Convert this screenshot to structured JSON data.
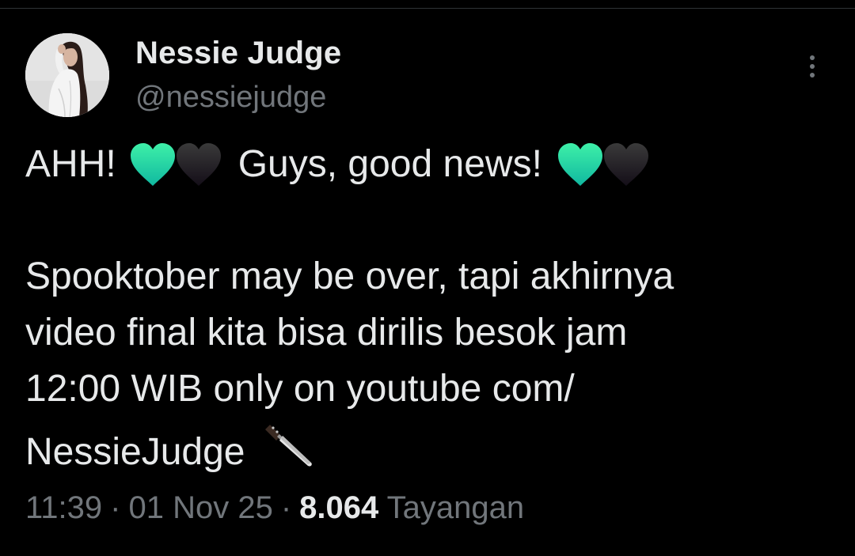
{
  "tweet": {
    "author": {
      "display_name": "Nessie Judge",
      "handle": "@nessiejudge",
      "avatar_icon": "profile-photo"
    },
    "more_icon": "more-vertical-icon",
    "text": {
      "line1_part1": "AHH!",
      "line1_part2": "Guys, good news!",
      "line3": "Spooktober may be over, tapi akhirnya",
      "line4": "video final kita bisa dirilis besok jam",
      "line5": "12:00 WIB only on youtube com/",
      "line6": "NessieJudge"
    },
    "emojis": [
      "green-heart-icon",
      "black-heart-icon",
      "green-heart-icon",
      "black-heart-icon",
      "knife-icon"
    ],
    "meta": {
      "time": "11:39",
      "separator": "·",
      "date": "01 Nov 25",
      "views_count": "8.064",
      "views_label": "Tayangan"
    },
    "colors": {
      "background": "#000000",
      "primary_text": "#e7e9ea",
      "secondary_text": "#71767b",
      "green_heart": "#20d89a"
    }
  }
}
